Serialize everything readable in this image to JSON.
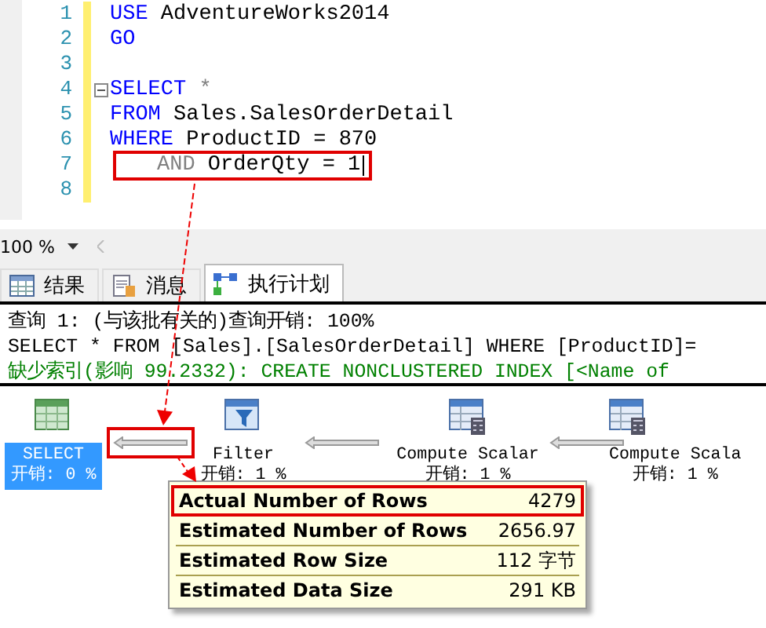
{
  "editor": {
    "lines": [
      {
        "number": "1",
        "fold_start": false,
        "highlighted": false,
        "tokens": [
          {
            "text": "USE",
            "kind": "keyword"
          },
          {
            "text": " AdventureWorks2014",
            "kind": "plain"
          }
        ]
      },
      {
        "number": "2",
        "fold_start": false,
        "highlighted": false,
        "tokens": [
          {
            "text": "GO",
            "kind": "keyword"
          }
        ]
      },
      {
        "number": "3",
        "fold_start": false,
        "highlighted": false
      },
      {
        "number": "4",
        "fold_start": true,
        "highlighted": false,
        "tokens": [
          {
            "text": "SELECT",
            "kind": "keyword"
          },
          {
            "text": " *",
            "kind": "operator"
          }
        ]
      },
      {
        "number": "5",
        "fold_start": false,
        "highlighted": false,
        "tokens": [
          {
            "text": "FROM",
            "kind": "keyword"
          },
          {
            "text": " Sales.SalesOrderDetail",
            "kind": "plain"
          }
        ]
      },
      {
        "number": "6",
        "fold_start": false,
        "highlighted": false,
        "tokens": [
          {
            "text": "WHERE",
            "kind": "keyword"
          },
          {
            "text": " ProductID = 870",
            "kind": "plain"
          }
        ]
      },
      {
        "number": "7",
        "fold_start": false,
        "highlighted": true,
        "tokens": [
          {
            "text": "AND",
            "kind": "operator"
          },
          {
            "text": " OrderQty = 1",
            "kind": "plain"
          }
        ]
      },
      {
        "number": "8",
        "fold_start": false,
        "highlighted": false
      }
    ]
  },
  "zoom": {
    "value": "100 %"
  },
  "tabs": [
    {
      "label": "结果",
      "selected": false
    },
    {
      "label": "消息",
      "selected": false
    },
    {
      "label": "执行计划",
      "selected": true
    }
  ],
  "messages": [
    {
      "kind": "header",
      "text": "查询 1: (与该批有关的)查询开销: 100%"
    },
    {
      "kind": "sql",
      "text": "SELECT * FROM [Sales].[SalesOrderDetail] WHERE [ProductID]="
    },
    {
      "kind": "missing_index",
      "text": "缺少索引(影响 99.2332): CREATE NONCLUSTERED INDEX [<Name of"
    }
  ],
  "plan": {
    "nodes": [
      {
        "name": "SELECT",
        "cost": "开销: 0 %",
        "kind": "select",
        "selected": true
      },
      {
        "name": "Filter",
        "cost": "开销: 1 %",
        "kind": "filter",
        "selected": false
      },
      {
        "name": "Compute Scalar",
        "cost": "开销: 1 %",
        "kind": "compute",
        "selected": false
      },
      {
        "name": "Compute Scala",
        "cost": "开销: 1 %",
        "kind": "compute",
        "selected": false
      }
    ],
    "arrows": [
      {
        "highlighted": true
      },
      {
        "highlighted": false
      },
      {
        "highlighted": false
      }
    ],
    "tooltip": {
      "rows": [
        {
          "label": "Actual Number of Rows",
          "value": "4279",
          "highlighted": true
        },
        {
          "label": "Estimated Number of Rows",
          "value": "2656.97",
          "highlighted": false
        },
        {
          "label": "Estimated Row Size",
          "value": "112 字节",
          "highlighted": false
        },
        {
          "label": "Estimated Data Size",
          "value": "291 KB",
          "highlighted": false
        }
      ]
    }
  }
}
